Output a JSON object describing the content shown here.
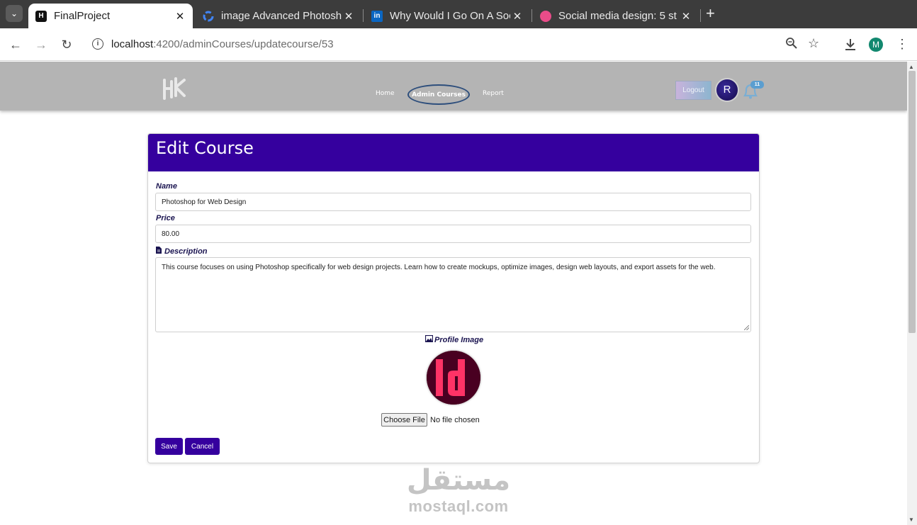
{
  "browser": {
    "tabs": [
      {
        "title": "FinalProject",
        "active": true,
        "favicon": "h-logo-icon"
      },
      {
        "title": "image Advanced Photosh",
        "active": false,
        "favicon": "google-icon"
      },
      {
        "title": "Why Would I Go On A Soc",
        "active": false,
        "favicon": "linkedin-icon"
      },
      {
        "title": "Social media design: 5 st",
        "active": false,
        "favicon": "dribbble-icon"
      }
    ],
    "url_host": "localhost",
    "url_path": ":4200/adminCourses/updatecourse/53",
    "profile_initial": "M"
  },
  "app": {
    "nav": {
      "links": [
        "Home",
        "Admin Courses",
        "Report"
      ],
      "active": "Admin Courses",
      "logout_label": "Logout",
      "avatar_text": "R",
      "notification_count": "11"
    },
    "form": {
      "title": "Edit Course",
      "name_label": "Name",
      "name_value": "Photoshop for Web Design",
      "price_label": "Price",
      "price_value": "80.00",
      "description_label": "Description",
      "description_value": "This course focuses on using Photoshop specifically for web design projects. Learn how to create mockups, optimize images, design web layouts, and export assets for the web.",
      "image_label": "Profile Image",
      "choose_file_label": "Choose File",
      "no_file_text": "No file chosen",
      "save_label": "Save",
      "cancel_label": "Cancel"
    }
  },
  "watermark": {
    "arabic": "مستقل",
    "latin": "mostaql.com"
  },
  "colors": {
    "header": "#35009e",
    "navbar": "#b4b4b4",
    "accent": "#35009e"
  }
}
